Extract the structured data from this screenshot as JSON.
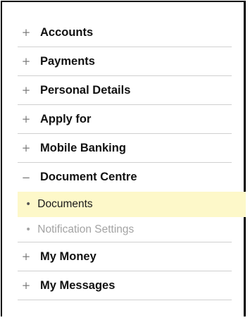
{
  "menu": {
    "items": [
      {
        "label": "Accounts",
        "expander": "+"
      },
      {
        "label": "Payments",
        "expander": "+"
      },
      {
        "label": "Personal Details",
        "expander": "+"
      },
      {
        "label": "Apply for",
        "expander": "+"
      },
      {
        "label": "Mobile Banking",
        "expander": "+"
      },
      {
        "label": "Document Centre",
        "expander": "−"
      },
      {
        "label": "My Money",
        "expander": "+"
      },
      {
        "label": "My Messages",
        "expander": "+"
      }
    ],
    "document_centre_sub": [
      {
        "label": "Documents",
        "bullet": "•",
        "state": "selected"
      },
      {
        "label": "Notification Settings",
        "bullet": "•",
        "state": "disabled"
      }
    ]
  },
  "icons": {
    "expand": "plus-icon",
    "collapse": "minus-icon",
    "bullet": "bullet-icon"
  },
  "colors": {
    "selected_background": "#fdf8c9",
    "divider": "#d0d0d0",
    "disabled_text": "#a3a3a3",
    "frame_border": "#000000"
  }
}
